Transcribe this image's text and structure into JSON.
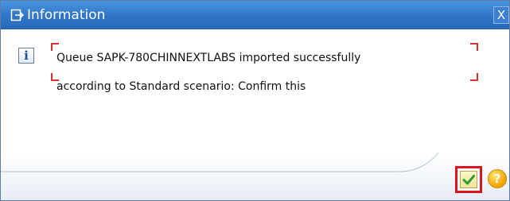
{
  "window": {
    "title": "Information",
    "close_label": "X"
  },
  "message": {
    "line1": "Queue SAPK-780CHINNEXTLABS imported successfully",
    "line2": "according to Standard scenario: Confirm this"
  },
  "icons": {
    "title": "dialog-window-icon",
    "message": "information-icon",
    "confirm": "green-checkmark-icon",
    "help": "question-mark-icon"
  },
  "help": {
    "glyph": "?"
  },
  "colors": {
    "titlebar": "#2f74c7",
    "focus_highlight": "#d9161e",
    "confirm_check": "#2e9d2e",
    "help_button": "#f2a200"
  }
}
